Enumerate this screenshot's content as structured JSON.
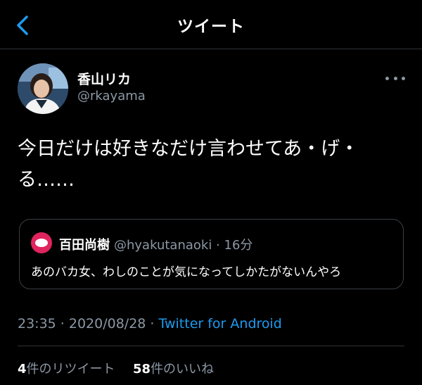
{
  "header": {
    "title": "ツイート",
    "back_icon": "chevron-left-icon"
  },
  "tweet": {
    "author": {
      "name": "香山リカ",
      "handle": "@rkayama"
    },
    "text": "今日だけは好きなだけ言わせてあ・げ・る……",
    "more_icon": "more-horizontal-icon",
    "quoted": {
      "name": "百田尚樹",
      "meta": "@hyakutanaoki · 16分",
      "text": "あのバカ女、わしのことが気になってしかたがないんやろ"
    },
    "time": "23:35 · 2020/08/28 · ",
    "source": "Twitter for Android",
    "stats": {
      "retweets_count": "4",
      "retweets_label": "件のリツイート",
      "likes_count": "58",
      "likes_label": "件のいいね"
    }
  },
  "colors": {
    "background": "#000000",
    "accent": "#1d9bf0",
    "muted": "#8b98a5",
    "divider": "#2f3336"
  }
}
